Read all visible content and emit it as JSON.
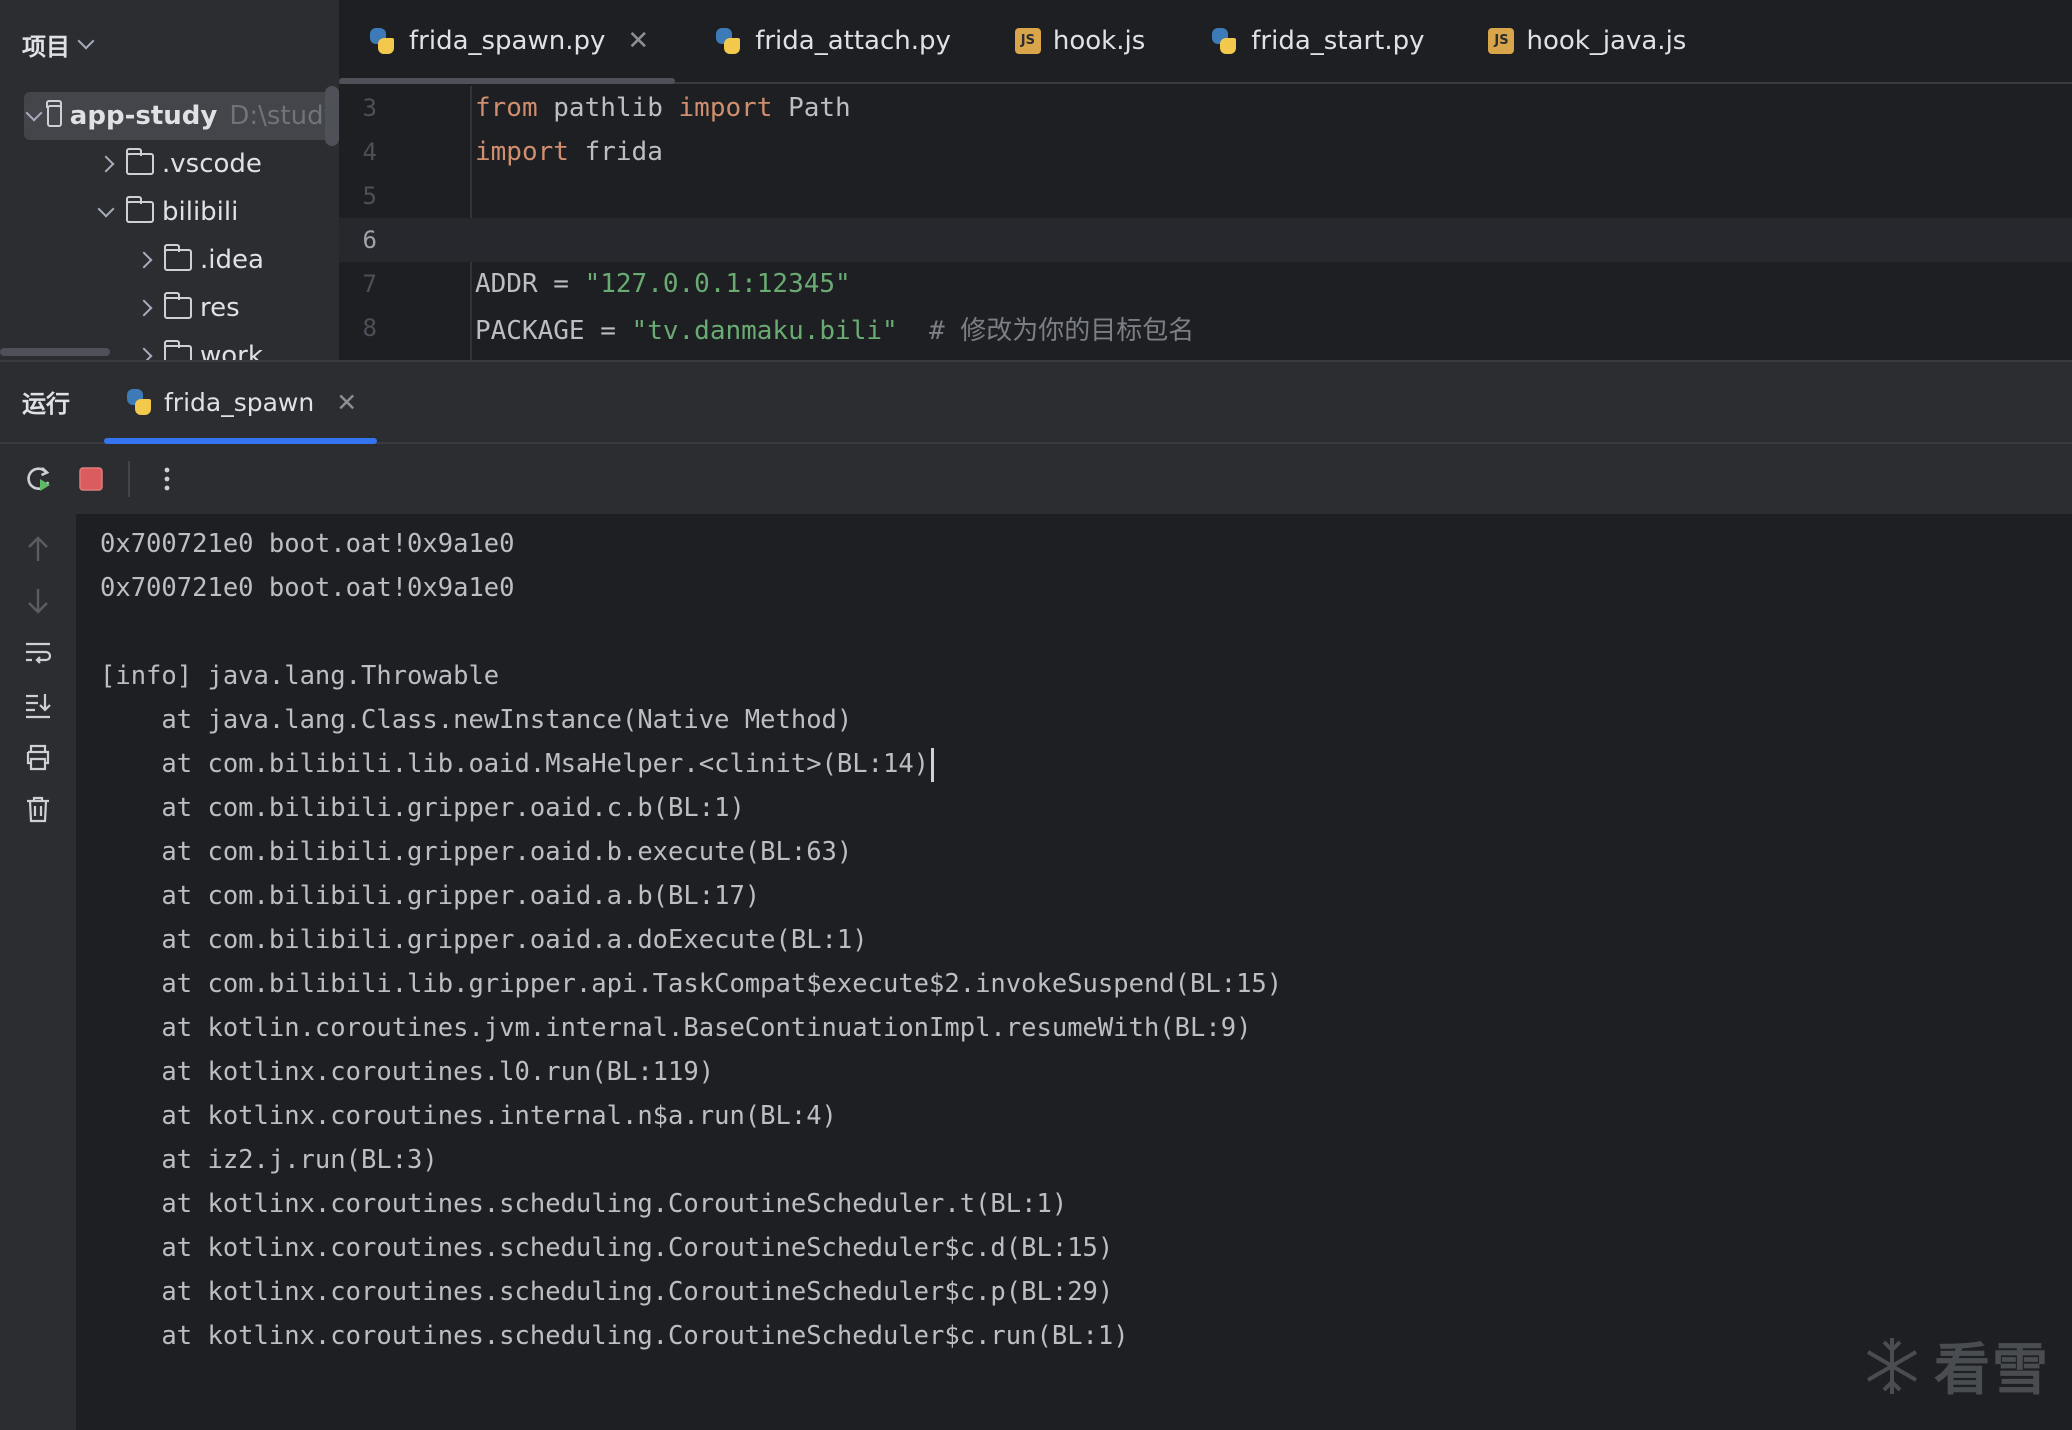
{
  "project": {
    "title": "项目",
    "tree": [
      {
        "name": "app-study",
        "path": "D:\\study",
        "expanded": true,
        "bold": true,
        "level": 0
      },
      {
        "name": ".vscode",
        "expanded": false,
        "level": 1
      },
      {
        "name": "bilibili",
        "expanded": true,
        "level": 1
      },
      {
        "name": ".idea",
        "expanded": false,
        "level": 2
      },
      {
        "name": "res",
        "expanded": false,
        "level": 2
      },
      {
        "name": "work",
        "expanded": false,
        "level": 2
      }
    ]
  },
  "tabs": [
    {
      "label": "frida_spawn.py",
      "icon": "python-icon",
      "active": true,
      "closable": true
    },
    {
      "label": "frida_attach.py",
      "icon": "python-icon"
    },
    {
      "label": "hook.js",
      "icon": "js-icon"
    },
    {
      "label": "frida_start.py",
      "icon": "python-icon"
    },
    {
      "label": "hook_java.js",
      "icon": "js-icon"
    }
  ],
  "editor": {
    "current_line": 6,
    "lines": [
      {
        "num": "3",
        "tokens": [
          [
            "kw",
            "from"
          ],
          [
            "p",
            " pathlib "
          ],
          [
            "kw",
            "import"
          ],
          [
            "p",
            " Path"
          ]
        ]
      },
      {
        "num": "4",
        "tokens": [
          [
            "kw",
            "import"
          ],
          [
            "p",
            " frida"
          ]
        ]
      },
      {
        "num": "5",
        "tokens": []
      },
      {
        "num": "6",
        "tokens": []
      },
      {
        "num": "7",
        "tokens": [
          [
            "p",
            "ADDR = "
          ],
          [
            "str",
            "\"127.0.0.1:12345\""
          ]
        ]
      },
      {
        "num": "8",
        "tokens": [
          [
            "p",
            "PACKAGE = "
          ],
          [
            "str",
            "\"tv.danmaku.bili\""
          ],
          [
            "p",
            "  "
          ],
          [
            "cmt",
            "# 修改为你的目标包名"
          ]
        ]
      }
    ]
  },
  "run": {
    "title": "运行",
    "tab_label": "frida_spawn",
    "toolbar": {
      "rerun_icon": "rerun-icon",
      "stop_icon": "stop-icon",
      "more_icon": "more-vertical-icon"
    },
    "console_lines": [
      "0x700721e0 boot.oat!0x9a1e0",
      "0x700721e0 boot.oat!0x9a1e0",
      "",
      "[info] java.lang.Throwable",
      "    at java.lang.Class.newInstance(Native Method)",
      "    at com.bilibili.lib.oaid.MsaHelper.<clinit>(BL:14)",
      "    at com.bilibili.gripper.oaid.c.b(BL:1)",
      "    at com.bilibili.gripper.oaid.b.execute(BL:63)",
      "    at com.bilibili.gripper.oaid.a.b(BL:17)",
      "    at com.bilibili.gripper.oaid.a.doExecute(BL:1)",
      "    at com.bilibili.lib.gripper.api.TaskCompat$execute$2.invokeSuspend(BL:15)",
      "    at kotlin.coroutines.jvm.internal.BaseContinuationImpl.resumeWith(BL:9)",
      "    at kotlinx.coroutines.l0.run(BL:119)",
      "    at kotlinx.coroutines.internal.n$a.run(BL:4)",
      "    at iz2.j.run(BL:3)",
      "    at kotlinx.coroutines.scheduling.CoroutineScheduler.t(BL:1)",
      "    at kotlinx.coroutines.scheduling.CoroutineScheduler$c.d(BL:15)",
      "    at kotlinx.coroutines.scheduling.CoroutineScheduler$c.p(BL:29)",
      "    at kotlinx.coroutines.scheduling.CoroutineScheduler$c.run(BL:1)"
    ],
    "cursor_line": 5
  },
  "watermark": {
    "text": "看雪",
    "icon": "snowflake-icon"
  },
  "colors": {
    "accent": "#3574f0",
    "stop": "#db5c5c",
    "rerun": "#5fb865"
  }
}
